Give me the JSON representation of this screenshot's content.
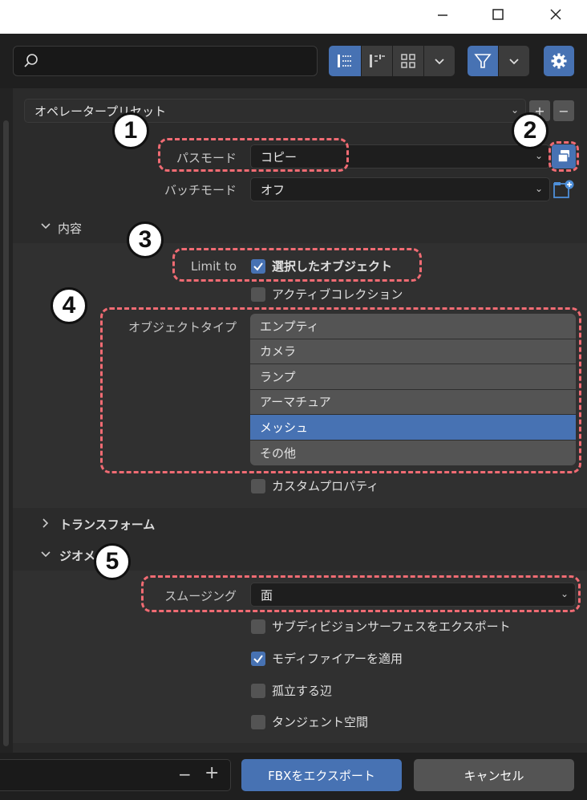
{
  "preset": {
    "label": "オペレータープリセット"
  },
  "path_mode": {
    "label": "パスモード",
    "value": "コピー"
  },
  "batch_mode": {
    "label": "バッチモード",
    "value": "オフ"
  },
  "sections": {
    "contents": "内容",
    "transform": "トランスフォーム",
    "geometry": "ジオメトリ"
  },
  "limit_to": {
    "label": "Limit to",
    "selected_objects": "選択したオブジェクト",
    "active_collection": "アクティブコレクション"
  },
  "object_type": {
    "label": "オブジェクトタイプ",
    "items": [
      "エンプティ",
      "カメラ",
      "ランプ",
      "アーマチュア",
      "メッシュ",
      "その他"
    ],
    "selected_index": 4
  },
  "custom_properties": "カスタムプロパティ",
  "smoothing": {
    "label": "スムージング",
    "value": "面"
  },
  "geometry_options": {
    "subdivision": "サブディビジョンサーフェスをエクスポート",
    "apply_modifiers": "モディファイアーを適用",
    "loose_edges": "孤立する辺",
    "tangent_space": "タンジェント空間"
  },
  "buttons": {
    "export": "FBXをエクスポート",
    "cancel": "キャンセル"
  },
  "annotations": [
    "1",
    "2",
    "3",
    "4",
    "5"
  ],
  "colors": {
    "accent": "#4772b3",
    "annotation": "#f06b73"
  }
}
